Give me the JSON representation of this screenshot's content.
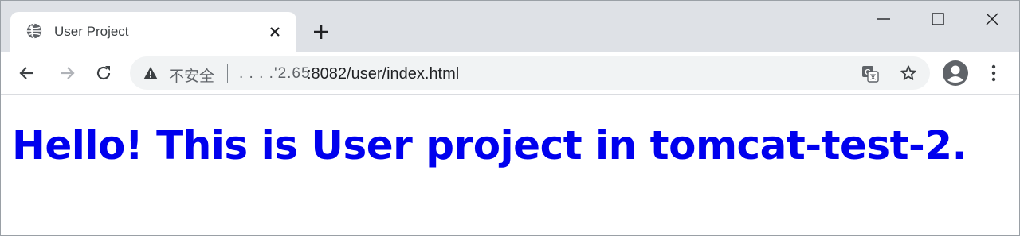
{
  "browser": {
    "tab": {
      "title": "User Project",
      "favicon": "globe-icon"
    },
    "window_controls": [
      "minimize-icon",
      "maximize-icon",
      "close-icon"
    ]
  },
  "toolbar": {
    "security_label": "不安全",
    "url_host_fragment": ". .   .  .'2.65",
    "url": ":8082/user/index.html"
  },
  "page": {
    "heading": "Hello! This is User project in tomcat-test-2."
  },
  "colors": {
    "heading": "#0000ee",
    "tabstrip": "#dee1e6",
    "omnibox": "#f1f3f4"
  }
}
